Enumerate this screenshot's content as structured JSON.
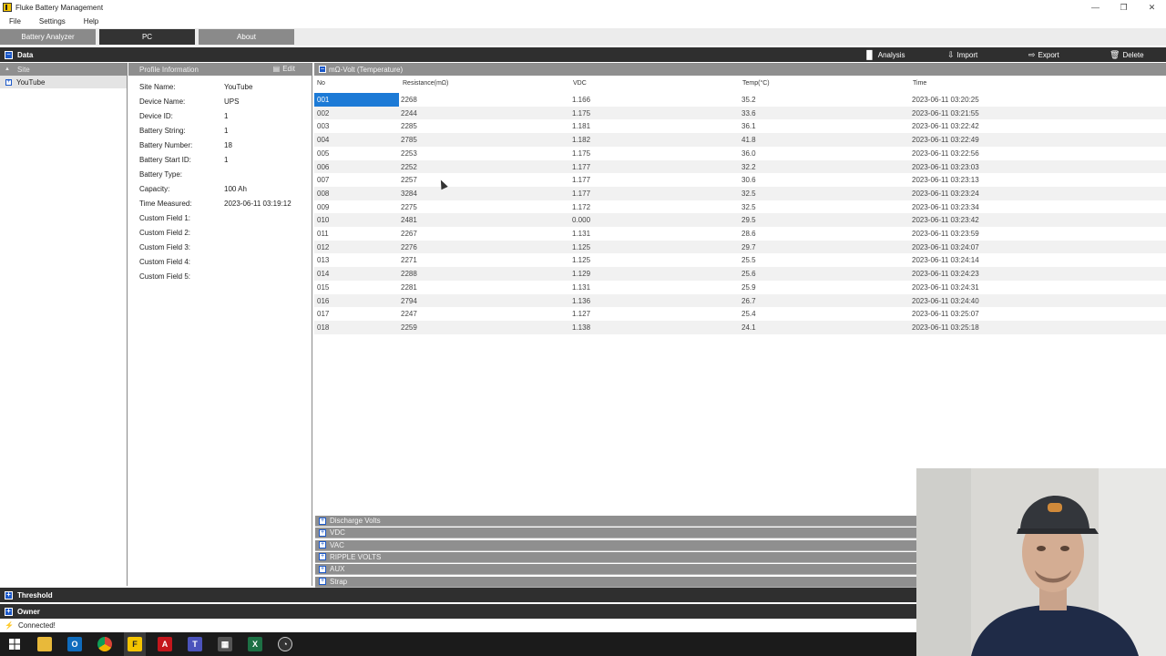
{
  "window": {
    "title": "Fluke Battery Management"
  },
  "menu": [
    "File",
    "Settings",
    "Help"
  ],
  "top_tabs": {
    "analyzer": "Battery Analyzer",
    "pc": "PC",
    "about": "About"
  },
  "data_section": {
    "title": "Data",
    "toolbar": {
      "analysis": "Analysis",
      "import": "Import",
      "export": "Export",
      "delete": "Delete"
    }
  },
  "sidebar": {
    "header": "Site",
    "items": [
      "YouTube"
    ]
  },
  "profile": {
    "header": "Profile Information",
    "edit_label": "Edit",
    "fields": [
      {
        "label": "Site Name:",
        "value": "YouTube"
      },
      {
        "label": "Device Name:",
        "value": "UPS"
      },
      {
        "label": "Device ID:",
        "value": "1"
      },
      {
        "label": "Battery String:",
        "value": "1"
      },
      {
        "label": "Battery Number:",
        "value": "18"
      },
      {
        "label": "Battery Start ID:",
        "value": "1"
      },
      {
        "label": "Battery Type:",
        "value": ""
      },
      {
        "label": "Capacity:",
        "value": "100 Ah"
      },
      {
        "label": "Time Measured:",
        "value": "2023-06-11 03:19:12"
      },
      {
        "label": "Custom Field 1:",
        "value": ""
      },
      {
        "label": "Custom Field 2:",
        "value": ""
      },
      {
        "label": "Custom Field 3:",
        "value": ""
      },
      {
        "label": "Custom Field 4:",
        "value": ""
      },
      {
        "label": "Custom Field 5:",
        "value": ""
      }
    ]
  },
  "grid": {
    "title": "mΩ-Volt (Temperature)",
    "columns": [
      "No",
      "Resistance(mΩ)",
      "VDC",
      "Temp(°C)",
      "Time"
    ],
    "rows": [
      [
        "001",
        "2268",
        "1.166",
        "35.2",
        "2023-06-11 03:20:25"
      ],
      [
        "002",
        "2244",
        "1.175",
        "33.6",
        "2023-06-11 03:21:55"
      ],
      [
        "003",
        "2285",
        "1.181",
        "36.1",
        "2023-06-11 03:22:42"
      ],
      [
        "004",
        "2785",
        "1.182",
        "41.8",
        "2023-06-11 03:22:49"
      ],
      [
        "005",
        "2253",
        "1.175",
        "36.0",
        "2023-06-11 03:22:56"
      ],
      [
        "006",
        "2252",
        "1.177",
        "32.2",
        "2023-06-11 03:23:03"
      ],
      [
        "007",
        "2257",
        "1.177",
        "30.6",
        "2023-06-11 03:23:13"
      ],
      [
        "008",
        "3284",
        "1.177",
        "32.5",
        "2023-06-11 03:23:24"
      ],
      [
        "009",
        "2275",
        "1.172",
        "32.5",
        "2023-06-11 03:23:34"
      ],
      [
        "010",
        "2481",
        "0.000",
        "29.5",
        "2023-06-11 03:23:42"
      ],
      [
        "011",
        "2267",
        "1.131",
        "28.6",
        "2023-06-11 03:23:59"
      ],
      [
        "012",
        "2276",
        "1.125",
        "29.7",
        "2023-06-11 03:24:07"
      ],
      [
        "013",
        "2271",
        "1.125",
        "25.5",
        "2023-06-11 03:24:14"
      ],
      [
        "014",
        "2288",
        "1.129",
        "25.6",
        "2023-06-11 03:24:23"
      ],
      [
        "015",
        "2281",
        "1.131",
        "25.9",
        "2023-06-11 03:24:31"
      ],
      [
        "016",
        "2794",
        "1.136",
        "26.7",
        "2023-06-11 03:24:40"
      ],
      [
        "017",
        "2247",
        "1.127",
        "25.4",
        "2023-06-11 03:25:07"
      ],
      [
        "018",
        "2259",
        "1.138",
        "24.1",
        "2023-06-11 03:25:18"
      ]
    ]
  },
  "sections": [
    "Discharge Volts",
    "VDC",
    "VAC",
    "RIPPLE VOLTS",
    "AUX",
    "Strap"
  ],
  "bottom": {
    "threshold": "Threshold",
    "owner": "Owner"
  },
  "status": {
    "text": "Connected!"
  },
  "colors": {
    "accent": "#1c7ad6",
    "dark_bar": "#2f2f2f",
    "panel_header": "#8f8f8f"
  }
}
